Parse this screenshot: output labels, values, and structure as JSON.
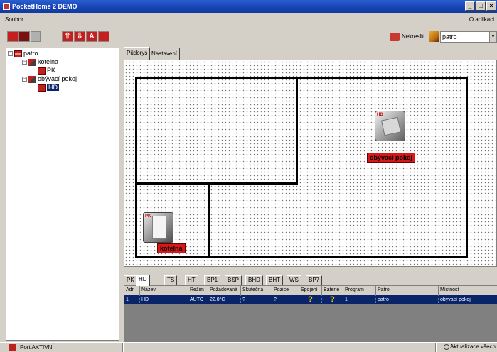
{
  "window": {
    "title": "PocketHome 2 DEMO",
    "min_label": "_",
    "max_label": "□",
    "close_label": "×"
  },
  "menu": {
    "file": "Soubor",
    "about": "O aplikaci"
  },
  "toolbar": {
    "up_label": "⇧",
    "down_label": "⇩",
    "letter_label": "A",
    "redraw_label": "Nekreslit",
    "floor_select": "patro"
  },
  "tree": {
    "root": "patro",
    "rooms": [
      {
        "label": "kotelna",
        "device": "PK"
      },
      {
        "label": "obývací pokoj",
        "device": "HD"
      }
    ]
  },
  "view_tabs": [
    "Půdorys",
    "Nastavení"
  ],
  "floorplan": {
    "rooms": [
      {
        "label": "obývací pokoj",
        "device": "HD"
      },
      {
        "label": "kotelna",
        "device": "PK"
      }
    ]
  },
  "device_tabs": [
    "PK",
    "HD",
    "TS",
    "HT",
    "BP1",
    "BSP",
    "BHD",
    "BHT",
    "WS",
    "BP7"
  ],
  "table": {
    "columns": [
      "Adr",
      "Název",
      "Režim",
      "Požadovaná",
      "Skutečná",
      "Pozice",
      "Spojení",
      "Baterie",
      "Program",
      "Patro",
      "Místnost"
    ],
    "rows": [
      [
        "1",
        "HD",
        "AUTO",
        "22.0°C",
        "?",
        "?",
        "?",
        "?",
        "1",
        "patro",
        "obývací pokoj"
      ]
    ]
  },
  "status": {
    "port": "Port AKTIVNÍ",
    "refresh": "Aktualizace všech"
  },
  "colors": {
    "selection": "#0a246a",
    "accent_red": "#d81818",
    "title_blue": "#1846b8"
  }
}
